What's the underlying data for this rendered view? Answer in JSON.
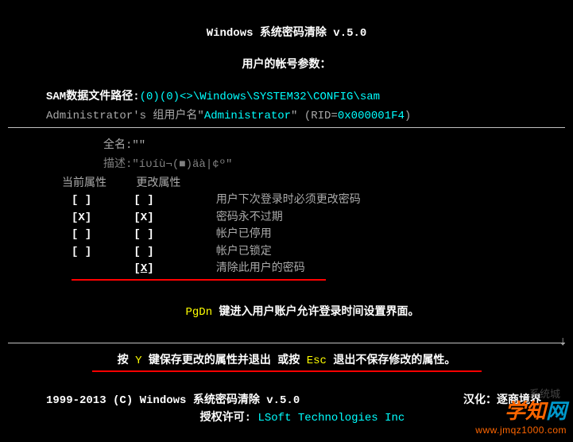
{
  "title": "Windows 系统密码清除 v.5.0",
  "subtitle": "用户的帐号参数：",
  "sam": {
    "label": "SAM数据文件路径:",
    "path": "(0)(0)<>\\Windows\\SYSTEM32\\CONFIG\\sam"
  },
  "admin": {
    "prefix": "Administrator's 组用户名\"",
    "username": "Administrator",
    "rid_label": "\" (RID=",
    "rid": "0x000001F4",
    "suffix": ")"
  },
  "fullname": {
    "label": "全名:",
    "value": "\"\""
  },
  "description": {
    "label": "描述:",
    "value": "\"íυíù¬(■)äà|¢º\""
  },
  "attr": {
    "header_current": "当前属性",
    "header_change": "更改属性",
    "rows": [
      {
        "c1": "[ ]",
        "c2": "[ ]",
        "desc": "用户下次登录时必须更改密码"
      },
      {
        "c1": "[X]",
        "c2": "[X]",
        "desc": "密码永不过期"
      },
      {
        "c1": "[ ]",
        "c2": "[ ]",
        "desc": "帐户已停用"
      },
      {
        "c1": "[ ]",
        "c2": "[ ]",
        "desc": "帐户已锁定"
      },
      {
        "c1": "",
        "c2": "[X]",
        "desc": "清除此用户的密码"
      }
    ]
  },
  "pgdn": {
    "key": "PgDn",
    "text": " 键进入用户账户允许登录时间设置界面。"
  },
  "save": {
    "prefix": "按 ",
    "key1": "Y",
    "mid1": " 键保存更改的属性并退出 或按 ",
    "key2": "Esc",
    "mid2": " 退出不保存修改的属性。"
  },
  "footer": {
    "copyright": "1999-2013 (C)  Windows 系统密码清除 v.5.0",
    "right_label": "汉化：逐商境界",
    "license_label": "授权许可:",
    "company": "  LSoft Technologies Inc"
  },
  "watermark": {
    "brand_1": "学知",
    "brand_2": "网",
    "url": "www.jmqz1000.com",
    "wm2": "系统城"
  }
}
